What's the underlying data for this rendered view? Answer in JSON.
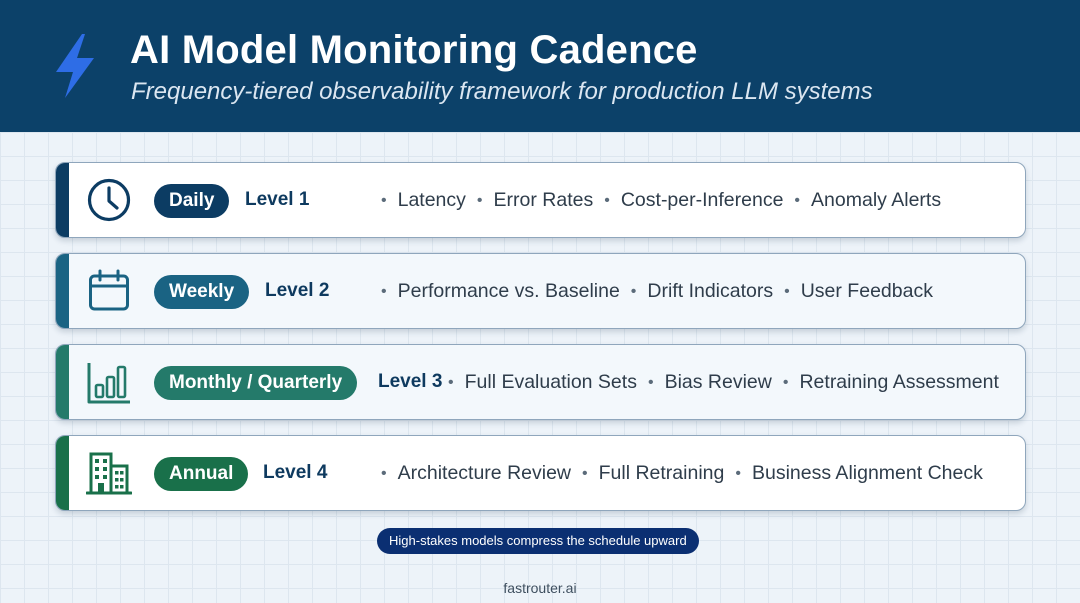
{
  "header": {
    "title": "AI Model Monitoring Cadence",
    "subtitle": "Frequency-tiered observability framework for production LLM systems",
    "icon": "lightning-bolt-icon",
    "background_color": "#0c4169",
    "icon_color": "#2e6de6"
  },
  "tiers": [
    {
      "frequency": "Daily",
      "level": "Level 1",
      "icon": "clock-icon",
      "color": "#0c3c63",
      "items": [
        "Latency",
        "Error Rates",
        "Cost-per-Inference",
        "Anomaly Alerts"
      ]
    },
    {
      "frequency": "Weekly",
      "level": "Level 2",
      "icon": "calendar-icon",
      "color": "#1a6383",
      "items": [
        "Performance vs. Baseline",
        "Drift Indicators",
        "User Feedback"
      ]
    },
    {
      "frequency": "Monthly / Quarterly",
      "level": "Level 3",
      "icon": "bar-chart-icon",
      "color": "#247a6a",
      "items": [
        "Full Evaluation Sets",
        "Bias Review",
        "Retraining Assessment"
      ]
    },
    {
      "frequency": "Annual",
      "level": "Level 4",
      "icon": "office-building-icon",
      "color": "#19704a",
      "items": [
        "Architecture Review",
        "Full Retraining",
        "Business Alignment Check"
      ]
    }
  ],
  "note": "High-stakes models compress the schedule upward",
  "footer": "fastrouter.ai"
}
